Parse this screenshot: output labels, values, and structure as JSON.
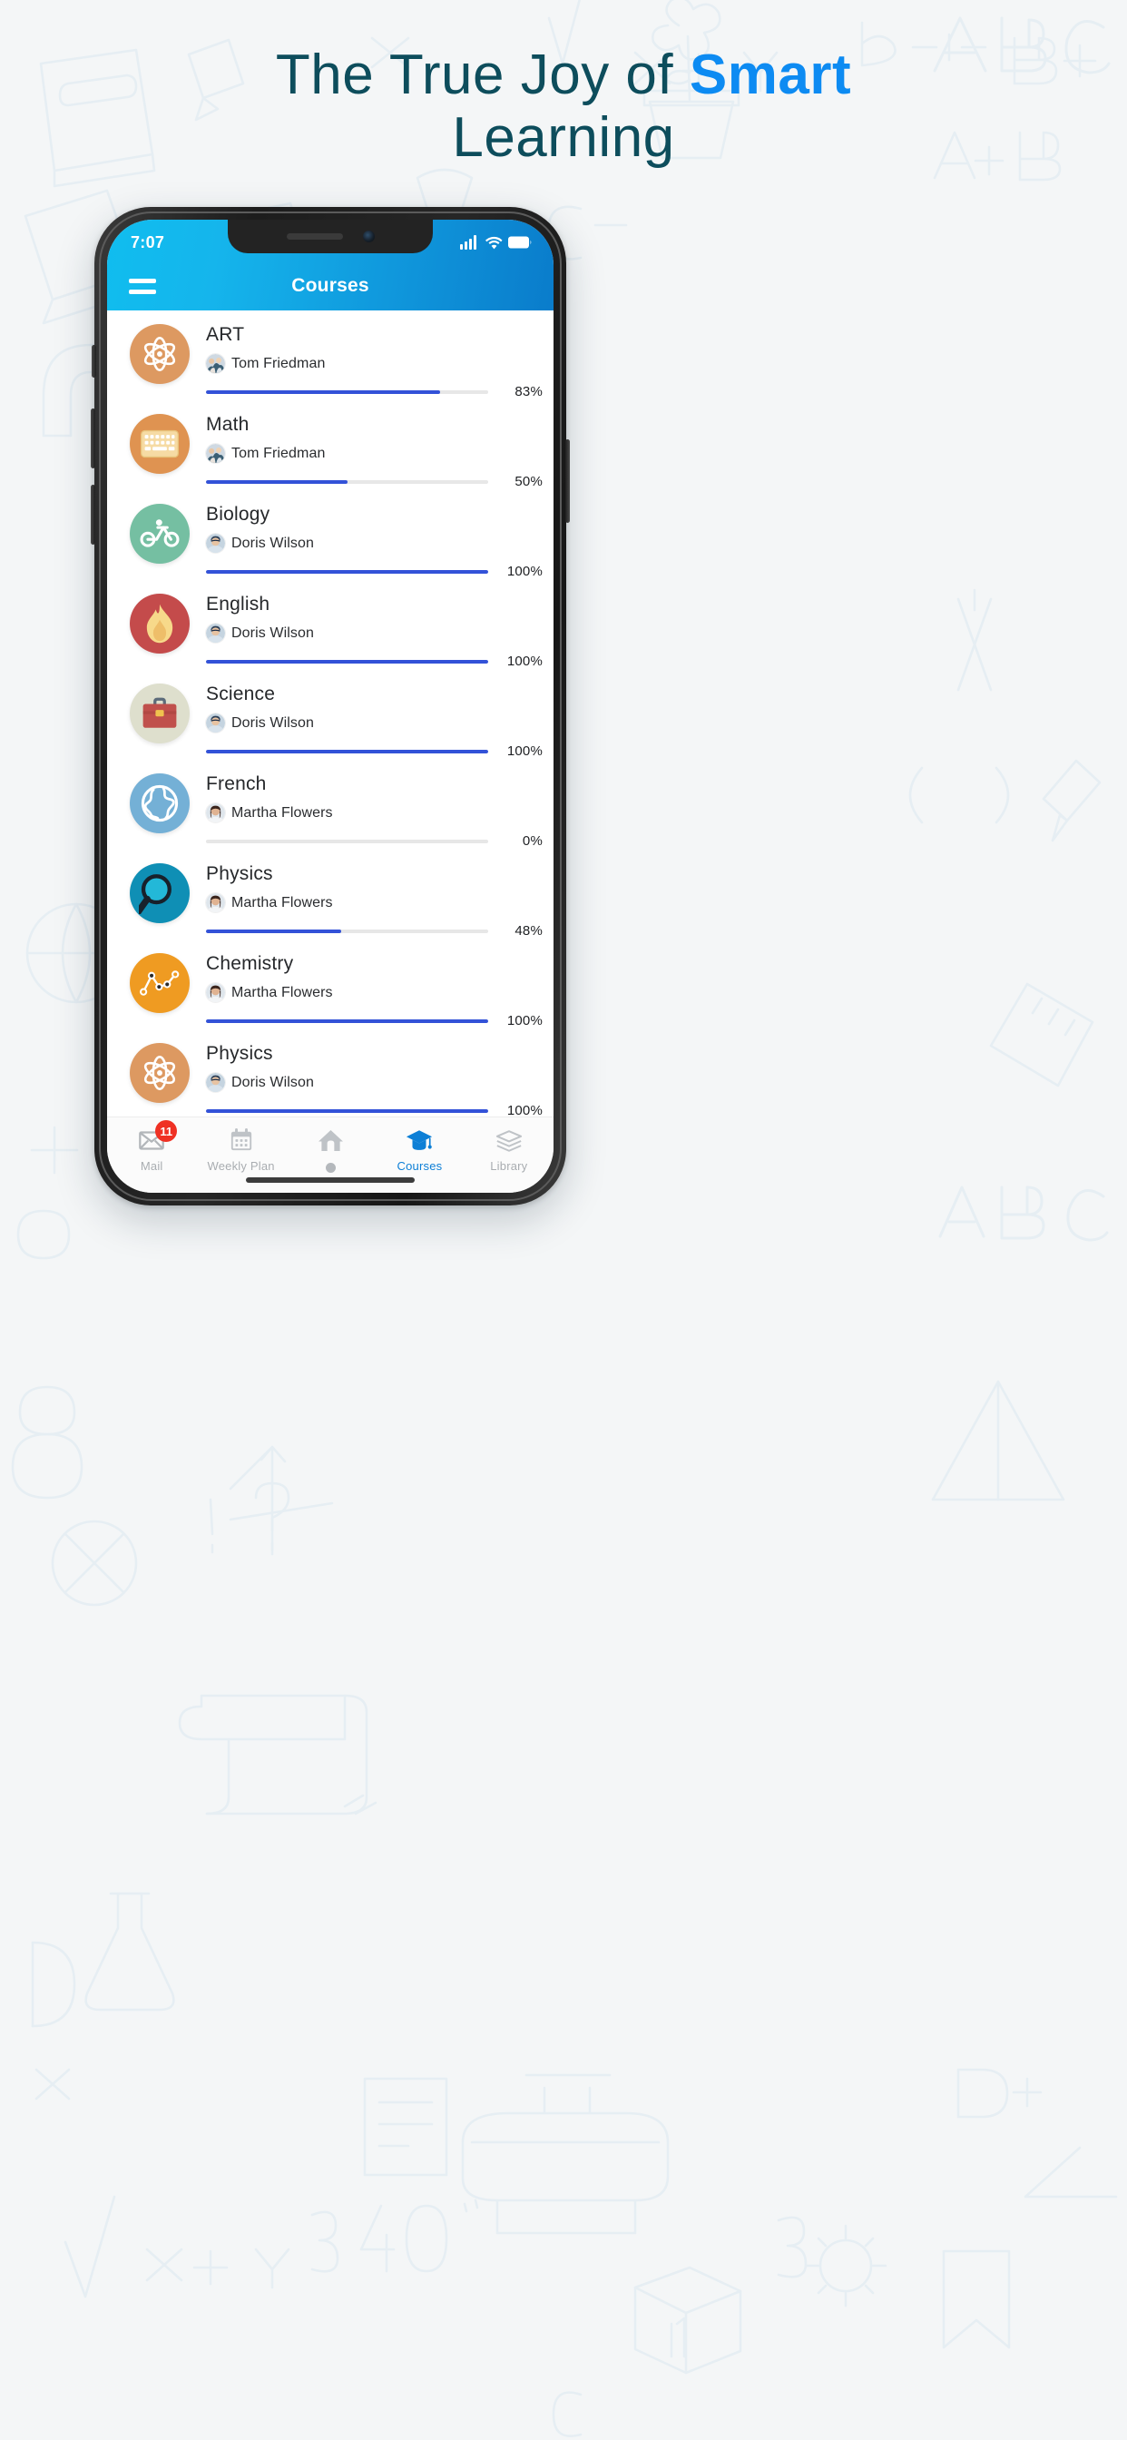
{
  "promo": {
    "headline_line1_plain": "The True Joy of ",
    "headline_line1_accent": "Smart",
    "headline_line2": "Learning",
    "accent_color": "#0d8bf2",
    "text_color": "#0d4d5c",
    "background_color": "#f4f6f7"
  },
  "phone": {
    "status_bar": {
      "time": "7:07",
      "icons": [
        "cellular-signal-icon",
        "wifi-icon",
        "battery-icon"
      ]
    },
    "app_bar": {
      "menu_icon": "hamburger-menu-icon",
      "title": "Courses",
      "gradient_from": "#10bdef",
      "gradient_to": "#0a7ccb"
    },
    "courses": [
      {
        "title": "ART",
        "teacher": "Tom Friedman",
        "percent": 83,
        "percent_label": "83%",
        "icon": "atom-icon",
        "icon_bg": "#dd9961"
      },
      {
        "title": "Math",
        "teacher": "Tom Friedman",
        "percent": 50,
        "percent_label": "50%",
        "icon": "keyboard-icon",
        "icon_bg": "#df9351"
      },
      {
        "title": "Biology",
        "teacher": "Doris Wilson",
        "percent": 100,
        "percent_label": "100%",
        "icon": "bicycle-icon",
        "icon_bg": "#75bfa2"
      },
      {
        "title": "English",
        "teacher": "Doris Wilson",
        "percent": 100,
        "percent_label": "100%",
        "icon": "flame-icon",
        "icon_bg": "#c44b4b"
      },
      {
        "title": "Science",
        "teacher": "Doris Wilson",
        "percent": 100,
        "percent_label": "100%",
        "icon": "briefcase-icon",
        "icon_bg": "#dedfcd"
      },
      {
        "title": "French",
        "teacher": "Martha Flowers",
        "percent": 0,
        "percent_label": "0%",
        "icon": "globe-icon",
        "icon_bg": "#74b0d6"
      },
      {
        "title": "Physics",
        "teacher": "Martha Flowers",
        "percent": 48,
        "percent_label": "48%",
        "icon": "magnifier-icon",
        "icon_bg": "#0f8fb5"
      },
      {
        "title": "Chemistry",
        "teacher": "Martha Flowers",
        "percent": 100,
        "percent_label": "100%",
        "icon": "line-chart-icon",
        "icon_bg": "#ef9b22"
      },
      {
        "title": "Physics",
        "teacher": "Doris Wilson",
        "percent": 100,
        "percent_label": "100%",
        "icon": "atom-icon",
        "icon_bg": "#dd9961"
      }
    ],
    "bottom_nav": {
      "active_color": "#0d7fd6",
      "inactive_color": "#a9adb1",
      "items": [
        {
          "label": "Mail",
          "icon": "envelope-icon",
          "badge": "11",
          "active": false
        },
        {
          "label": "Weekly Plan",
          "icon": "calendar-icon",
          "badge": "",
          "active": false
        },
        {
          "label": "",
          "icon": "home-icon",
          "badge": "",
          "active": false
        },
        {
          "label": "Courses",
          "icon": "graduation-cap-icon",
          "badge": "",
          "active": true
        },
        {
          "label": "Library",
          "icon": "books-icon",
          "badge": "",
          "active": false
        }
      ]
    },
    "progress_colors": {
      "fill": "#3352d8",
      "track": "#e7e7e7"
    }
  }
}
